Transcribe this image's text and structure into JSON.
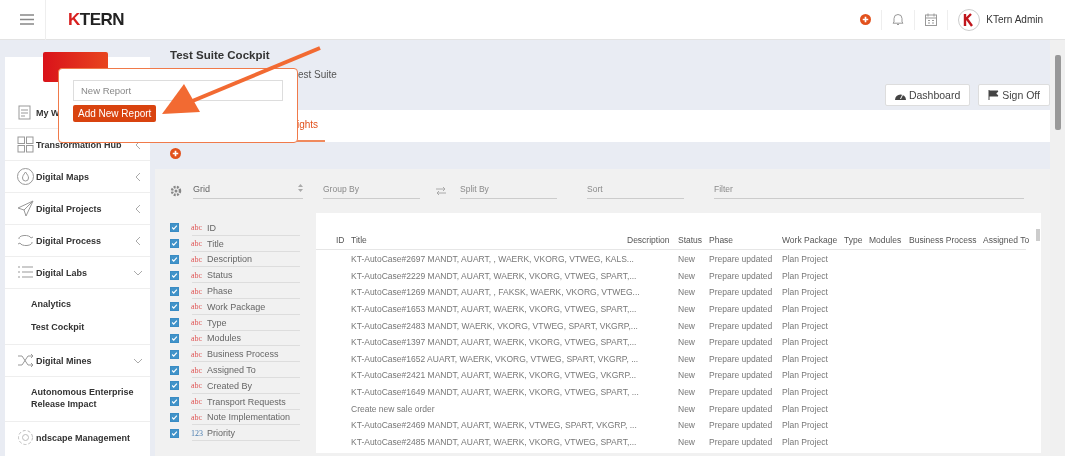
{
  "header": {
    "brand_mark": "K",
    "brand_rest": "TERN",
    "user": "KTern Admin"
  },
  "sidebar": {
    "items": [
      {
        "label": "My W"
      },
      {
        "label": "Transformation Hub",
        "expanded": false
      },
      {
        "label": "Digital Maps",
        "expanded": false
      },
      {
        "label": "Digital Projects",
        "expanded": false
      },
      {
        "label": "Digital Process",
        "expanded": false
      },
      {
        "label": "Digital Labs",
        "expanded": true,
        "children": [
          {
            "label": "Analytics"
          },
          {
            "label": "Test Cockpit"
          }
        ]
      },
      {
        "label": "Digital Mines",
        "expanded": true,
        "children": [
          {
            "label": "Autonomous Enterprise Release Impact"
          }
        ]
      },
      {
        "label": "ndscape Management"
      }
    ]
  },
  "page": {
    "title": "Test Suite Cockpit",
    "subtitle": "est Suite",
    "buttons": [
      "Dashboard",
      "Sign Off"
    ]
  },
  "tabs": [
    {
      "label": "ights",
      "selected": true
    }
  ],
  "popup": {
    "placeholder": "New Report",
    "button": "Add New Report"
  },
  "toolbar": {
    "view": "Grid",
    "group_by": "Group By",
    "split_by": "Split By",
    "sort": "Sort",
    "filter": "Filter"
  },
  "fields": [
    {
      "tag": "abc",
      "label": "ID",
      "checked": true
    },
    {
      "tag": "abc",
      "label": "Title",
      "checked": true
    },
    {
      "tag": "abc",
      "label": "Description",
      "checked": true
    },
    {
      "tag": "abc",
      "label": "Status",
      "checked": true
    },
    {
      "tag": "abc",
      "label": "Phase",
      "checked": true
    },
    {
      "tag": "abc",
      "label": "Work Package",
      "checked": true
    },
    {
      "tag": "abc",
      "label": "Type",
      "checked": true
    },
    {
      "tag": "abc",
      "label": "Modules",
      "checked": true
    },
    {
      "tag": "abc",
      "label": "Business Process",
      "checked": true
    },
    {
      "tag": "abc",
      "label": "Assigned To",
      "checked": true
    },
    {
      "tag": "abc",
      "label": "Created By",
      "checked": true
    },
    {
      "tag": "abc",
      "label": "Transport Requests",
      "checked": true
    },
    {
      "tag": "abc",
      "label": "Note Implementation",
      "checked": true
    },
    {
      "tag": "123",
      "label": "Priority",
      "checked": true
    }
  ],
  "table": {
    "columns": [
      "ID",
      "Title",
      "Description",
      "Status",
      "Phase",
      "Work Package",
      "Type",
      "Modules",
      "Business Process",
      "Assigned To"
    ],
    "rows": [
      {
        "title": "KT-AutoCase#2697 MANDT, AUART,  , WAERK, VKORG, VTWEG, KALS...",
        "status": "New",
        "phase": "Prepare updated",
        "work_package": "Plan Project"
      },
      {
        "title": "KT-AutoCase#2229 MANDT, AUART,  WAERK, VKORG, VTWEG, SPART,...",
        "status": "New",
        "phase": "Prepare updated",
        "work_package": "Plan Project"
      },
      {
        "title": "KT-AutoCase#1269 MANDT, AUART, , FAKSK, WAERK, VKORG, VTWEG...",
        "status": "New",
        "phase": "Prepare updated",
        "work_package": "Plan Project"
      },
      {
        "title": "KT-AutoCase#1653 MANDT, AUART,  WAERK, VKORG, VTWEG, SPART,...",
        "status": "New",
        "phase": "Prepare updated",
        "work_package": "Plan Project"
      },
      {
        "title": "KT-AutoCase#2483 MANDT,  WAERK, VKORG, VTWEG, SPART, VKGRP,...",
        "status": "New",
        "phase": "Prepare updated",
        "work_package": "Plan Project"
      },
      {
        "title": "KT-AutoCase#1397 MANDT, AUART,  WAERK, VKORG, VTWEG, SPART,...",
        "status": "New",
        "phase": "Prepare updated",
        "work_package": "Plan Project"
      },
      {
        "title": "KT-AutoCase#1652 AUART,  WAERK, VKORG, VTWEG, SPART, VKGRP, ...",
        "status": "New",
        "phase": "Prepare updated",
        "work_package": "Plan Project"
      },
      {
        "title": "KT-AutoCase#2421 MANDT, AUART,  WAERK, VKORG, VTWEG, VKGRP...",
        "status": "New",
        "phase": "Prepare updated",
        "work_package": "Plan Project"
      },
      {
        "title": "KT-AutoCase#1649 MANDT, AUART, WAERK, VKORG, VTWEG, SPART, ...",
        "status": "New",
        "phase": "Prepare updated",
        "work_package": "Plan Project"
      },
      {
        "title": "Create new sale order",
        "status": "New",
        "phase": "Prepare updated",
        "work_package": "Plan Project"
      },
      {
        "title": "KT-AutoCase#2469 MANDT, AUART,  WAERK, VTWEG, SPART, VKGRP, ...",
        "status": "New",
        "phase": "Prepare updated",
        "work_package": "Plan Project"
      },
      {
        "title": "KT-AutoCase#2485 MANDT, AUART,  WAERK, VKORG, VTWEG, SPART,...",
        "status": "New",
        "phase": "Prepare updated",
        "work_package": "Plan Project"
      }
    ]
  }
}
